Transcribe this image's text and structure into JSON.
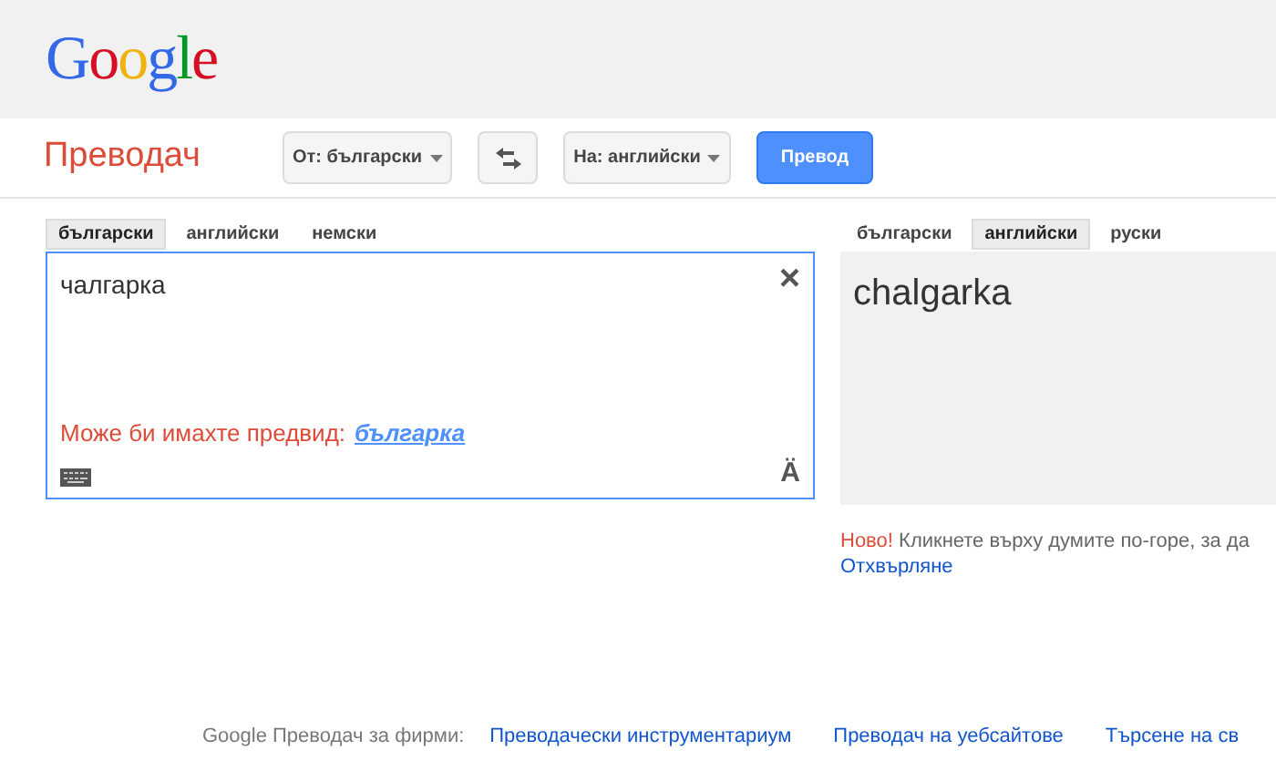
{
  "logo": {
    "text": "Google"
  },
  "toolbar": {
    "title": "Преводач",
    "source_select": "От: български",
    "target_select": "На: английски",
    "translate_button": "Превод"
  },
  "source": {
    "tabs": [
      {
        "label": "български",
        "selected": true
      },
      {
        "label": "английски",
        "selected": false
      },
      {
        "label": "немски",
        "selected": false
      }
    ],
    "value": "чалгарка",
    "clear_icon": "×",
    "suggestion_label": "Може би имахте предвид:",
    "suggestion_link": "българка",
    "accent_button": "Ä"
  },
  "target": {
    "tabs": [
      {
        "label": "български",
        "selected": false
      },
      {
        "label": "английски",
        "selected": true
      },
      {
        "label": "руски",
        "selected": false
      }
    ],
    "translation": "chalgarka"
  },
  "notice": {
    "badge": "Ново!",
    "text": "Кликнете върху думите по-горе, за да",
    "dismiss": "Отхвърляне"
  },
  "footer": {
    "label": "Google Преводач за фирми:",
    "links": [
      "Преводачески инструментариум",
      "Преводач на уебсайтове",
      "Търсене на св"
    ]
  }
}
